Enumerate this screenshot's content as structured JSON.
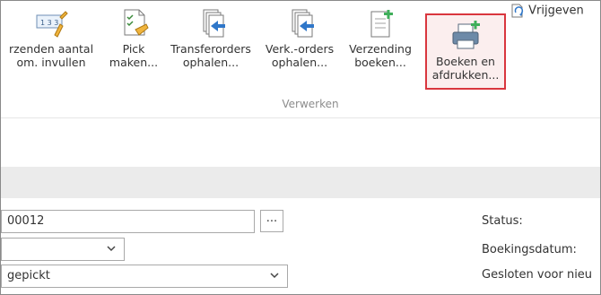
{
  "ribbon": {
    "buttons": [
      {
        "id": "fill-qty",
        "label_line1": "rzenden aantal",
        "label_line2": "om. invullen",
        "icon": "number-pencil-icon"
      },
      {
        "id": "pick",
        "label_line1": "Pick",
        "label_line2": "maken...",
        "icon": "document-check-icon"
      },
      {
        "id": "transfer-orders",
        "label_line1": "Transferorders",
        "label_line2": "ophalen...",
        "icon": "documents-arrow-icon"
      },
      {
        "id": "sales-orders",
        "label_line1": "Verk.-orders",
        "label_line2": "ophalen...",
        "icon": "documents-arrow-icon"
      },
      {
        "id": "post-shipment",
        "label_line1": "Verzending",
        "label_line2": "boeken...",
        "icon": "document-plus-icon"
      },
      {
        "id": "post-print",
        "label_line1": "Boeken en",
        "label_line2": "afdrukken...",
        "icon": "printer-plus-icon"
      }
    ],
    "release_label": "Vrijgeven",
    "group_label": "Verwerken"
  },
  "form": {
    "no_value": "00012",
    "ellipsis": "...",
    "location_value": "",
    "status_value": "gepickt",
    "labels": {
      "status": "Status:",
      "posting_date": "Boekingsdatum:",
      "closed_for": "Gesloten voor nieu"
    }
  },
  "colors": {
    "accent_red": "#d9363e",
    "arrow_blue": "#2f77c9",
    "plus_green": "#3fae5a",
    "band_gray": "#ebebeb"
  }
}
